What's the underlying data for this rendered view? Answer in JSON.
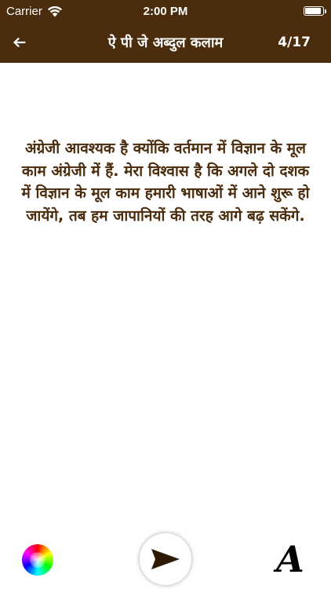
{
  "status_bar": {
    "carrier": "Carrier",
    "time": "2:00 PM",
    "icons": [
      "wifi-icon",
      "battery-icon"
    ]
  },
  "nav_bar": {
    "back_icon": "arrow-left-icon",
    "title": "ऐ पी जे  अब्दुल कलाम",
    "page_count": "4/17"
  },
  "quote": {
    "text": "अंग्रेजी आवश्यक है क्योंकि वर्तमान में विज्ञान के मूल काम अंग्रेजी में हैं. मेरा विश्वास है कि अगले दो दशक में विज्ञान के मूल काम हमारी भाषाओं में आने शुरू हो जायेंगे, तब हम जापानियों की तरह आगे बढ़ सकेंगे."
  },
  "toolbar": {
    "color_icon": "color-wheel-icon",
    "share_icon": "send-icon",
    "font_label": "A"
  },
  "colors": {
    "brand": "#4b2c0c",
    "text": "#4b2c0c",
    "background": "#ffffff"
  }
}
